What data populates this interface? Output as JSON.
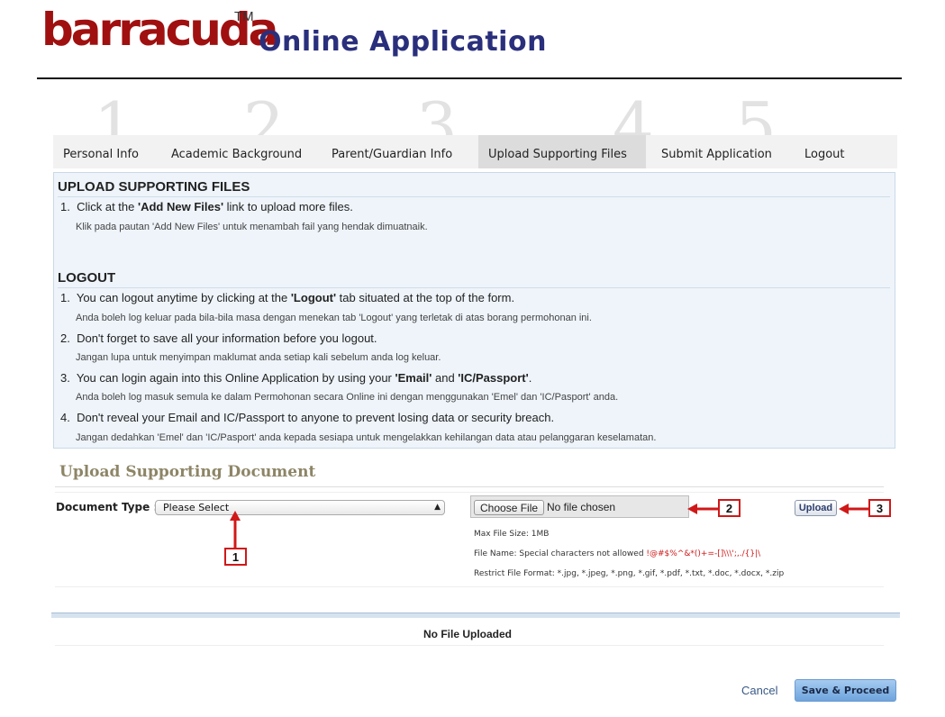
{
  "header": {
    "logo_text": "barracuda",
    "trademark": "TM",
    "app_title": "Online Application"
  },
  "steps": [
    "1",
    "2",
    "3",
    "4",
    "5"
  ],
  "tabs": [
    {
      "label": "Personal Info"
    },
    {
      "label": "Academic Background"
    },
    {
      "label": "Parent/Guardian Info"
    },
    {
      "label": "Upload Supporting Files",
      "active": true
    },
    {
      "label": "Submit Application"
    },
    {
      "label": "Logout"
    }
  ],
  "instructions": {
    "upload": {
      "title": "UPLOAD SUPPORTING FILES",
      "items": [
        {
          "num": "1.",
          "before": "Click at the ",
          "bold": "'Add New Files'",
          "after": " link to upload more files.",
          "sub": "Klik pada pautan 'Add New Files' untuk menambah fail yang hendak dimuatnaik."
        }
      ]
    },
    "logout": {
      "title": "LOGOUT",
      "item1": {
        "num": "1.",
        "before": "You can logout anytime by clicking at the ",
        "bold": "'Logout'",
        "after": " tab situated at the top of the form.",
        "sub": "Anda boleh log keluar pada bila-bila masa dengan menekan tab 'Logout' yang terletak di atas borang permohonan ini."
      },
      "item2": {
        "num": "2.",
        "text": "Don't forget to save all your information before you logout.",
        "sub": "Jangan lupa untuk menyimpan maklumat anda setiap kali sebelum anda log keluar."
      },
      "item3": {
        "num": "3.",
        "before": "You can login again into this Online Application by using your ",
        "bold1": "'Email'",
        "mid": " and ",
        "bold2": "'IC/Passport'",
        "after": ".",
        "sub": "Anda boleh log masuk semula ke dalam Permohonan secara Online ini dengan menggunakan 'Emel' dan 'IC/Pasport' anda."
      },
      "item4": {
        "num": "4.",
        "text": "Don't reveal your Email and IC/Passport to anyone to prevent losing data or security breach.",
        "sub": "Jangan dedahkan 'Emel' dan 'IC/Pasport' anda kepada sesiapa untuk mengelakkan kehilangan data atau pelanggaran keselamatan."
      }
    }
  },
  "upload_form": {
    "section_title": "Upload Supporting Document",
    "doc_type_label": "Document Type :",
    "doc_type_value": "Please Select",
    "choose_file_label": "Choose File",
    "no_file_chosen": "No file chosen",
    "upload_button": "Upload",
    "max_size": "Max File Size: 1MB",
    "filename_rule_prefix": "File Name: Special characters not allowed ",
    "filename_rule_chars": "!@#$%^&*()+=-[]\\\\\\';,./{}|\\",
    "format_rule": "Restrict File Format: *.jpg, *.jpeg, *.png, *.gif, *.pdf, *.txt, *.doc, *.docx, *.zip"
  },
  "callouts": [
    "1",
    "2",
    "3"
  ],
  "files_table": {
    "empty_text": "No File Uploaded"
  },
  "footer": {
    "cancel": "Cancel",
    "save": "Save & Proceed"
  },
  "colors": {
    "logo_red": "#a01010",
    "title_blue": "#2a2f7c",
    "info_bg": "#eef4fa",
    "callout_red": "#d01818",
    "save_blue": "#6ea4dc"
  }
}
